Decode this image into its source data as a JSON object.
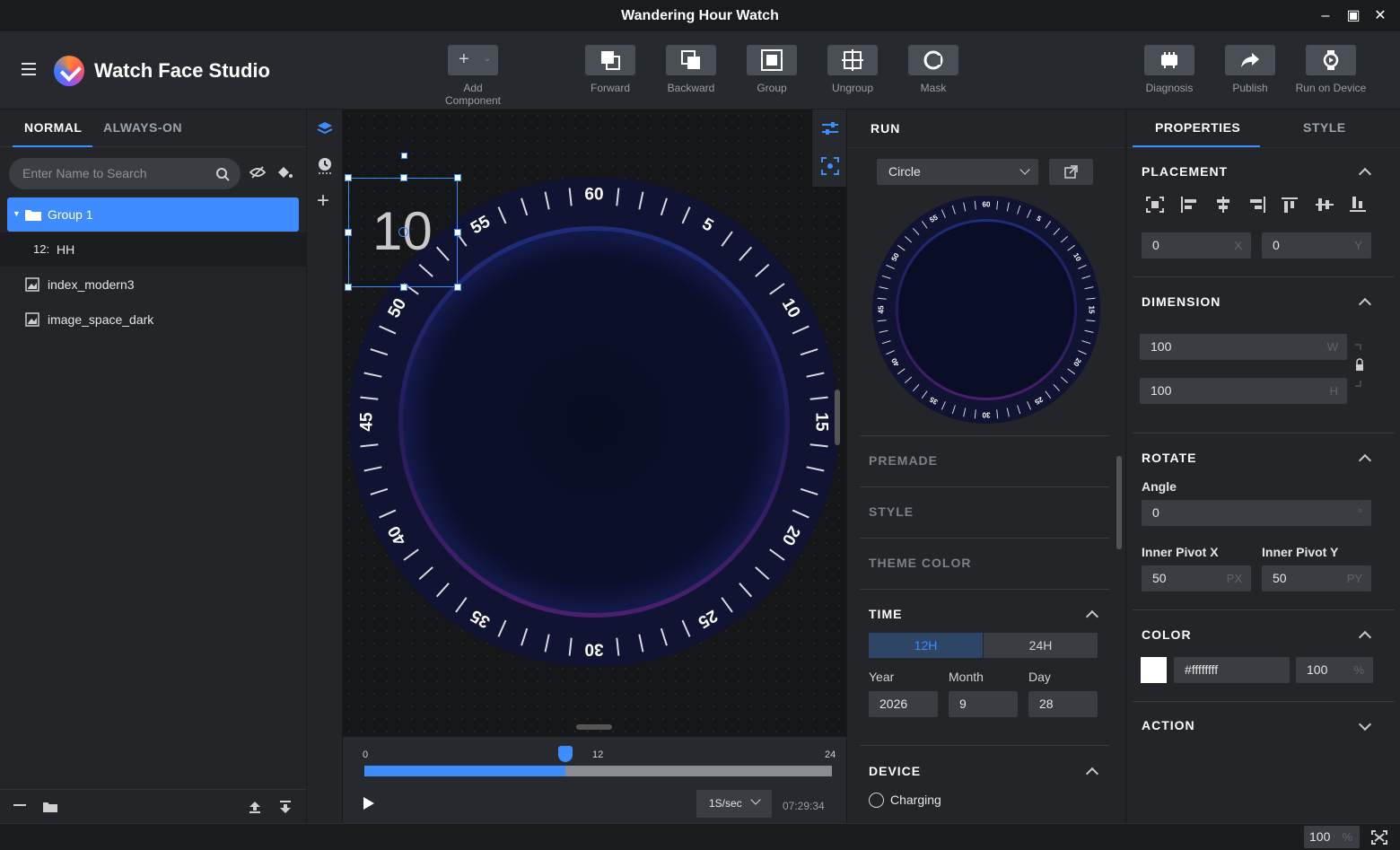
{
  "window": {
    "title": "Wandering Hour Watch",
    "minimize": "‒",
    "maximize": "▣",
    "close": "✕"
  },
  "app": {
    "name": "Watch Face Studio"
  },
  "toolbar": {
    "add_component": "Add Component",
    "forward": "Forward",
    "backward": "Backward",
    "group": "Group",
    "ungroup": "Ungroup",
    "mask": "Mask",
    "diagnosis": "Diagnosis",
    "publish": "Publish",
    "run_on_device": "Run on Device"
  },
  "left": {
    "tabs": [
      "NORMAL",
      "ALWAYS-ON"
    ],
    "search_placeholder": "Enter Name to Search",
    "layers": [
      {
        "label": "Group 1",
        "selected": true
      },
      {
        "prefix": "12:",
        "label": "HH"
      },
      {
        "label": "index_modern3"
      },
      {
        "label": "image_space_dark"
      }
    ]
  },
  "canvas": {
    "selected_text": "10",
    "bezel_numbers": [
      "60",
      "5",
      "10",
      "15",
      "20",
      "25",
      "30",
      "35",
      "40",
      "45",
      "50",
      "55"
    ]
  },
  "timeline": {
    "start": "0",
    "mid": "12",
    "end": "24",
    "position_fraction": 0.43,
    "speed": "1S/sec",
    "time": "07:29:34"
  },
  "run": {
    "title": "RUN",
    "shape_select": "Circle",
    "sections": {
      "premade": "PREMADE",
      "style": "STYLE",
      "theme_color": "THEME COLOR",
      "time": "TIME",
      "device": "DEVICE"
    },
    "time_modes": [
      "12H",
      "24H"
    ],
    "date_labels": {
      "year": "Year",
      "month": "Month",
      "day": "Day"
    },
    "date_values": {
      "year": "2026",
      "month": "9",
      "day": "28"
    },
    "charging": "Charging"
  },
  "props": {
    "tabs": [
      "PROPERTIES",
      "STYLE"
    ],
    "placement": {
      "title": "PLACEMENT",
      "x": "0",
      "y": "0",
      "x_unit": "X",
      "y_unit": "Y"
    },
    "dimension": {
      "title": "DIMENSION",
      "w": "100",
      "h": "100",
      "w_unit": "W",
      "h_unit": "H"
    },
    "rotate": {
      "title": "ROTATE",
      "angle_label": "Angle",
      "angle": "0",
      "angle_unit": "°",
      "pivot_x_label": "Inner Pivot X",
      "pivot_y_label": "Inner Pivot Y",
      "pivot_x": "50",
      "pivot_y": "50",
      "px": "PX",
      "py": "PY"
    },
    "color": {
      "title": "COLOR",
      "hex": "#ffffffff",
      "opacity": "100",
      "opacity_unit": "%",
      "swatch": "#ffffff"
    },
    "action": {
      "title": "ACTION"
    }
  },
  "status": {
    "zoom": "100",
    "zoom_unit": "%"
  },
  "colors": {
    "accent": "#3f8cff",
    "panel": "#232528",
    "toolbar": "#26292d"
  }
}
